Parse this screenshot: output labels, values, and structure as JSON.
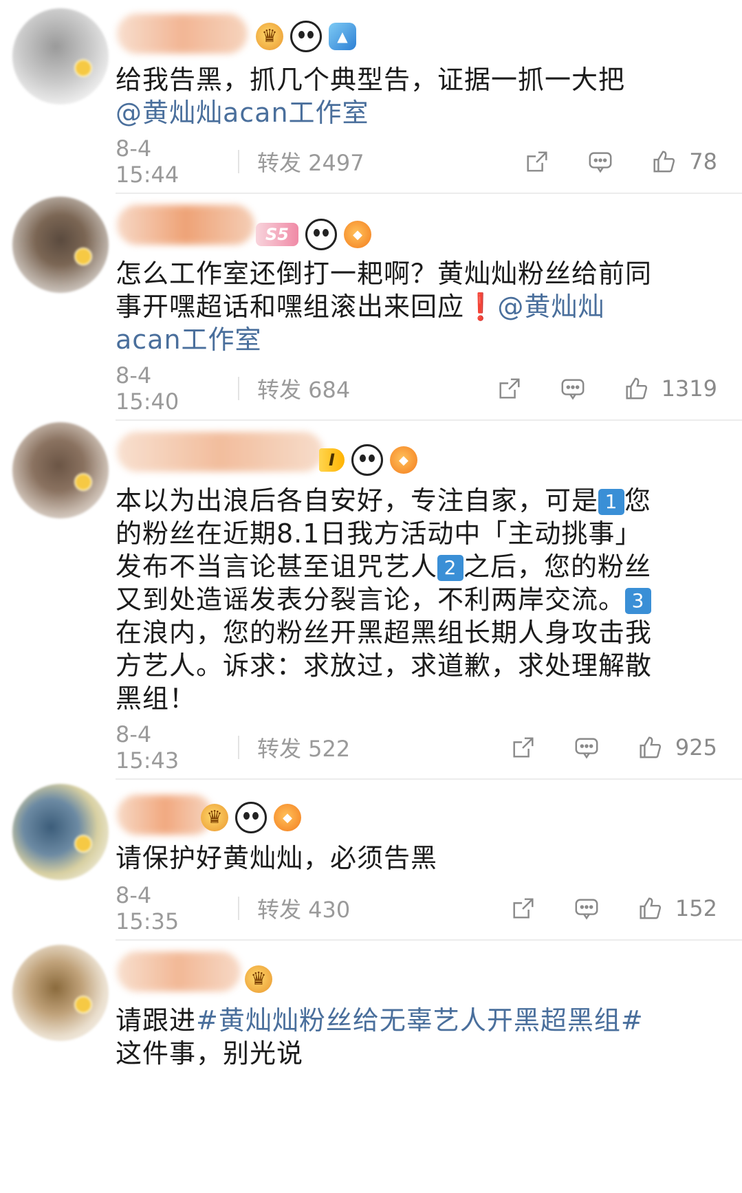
{
  "comments": [
    {
      "text_parts": [
        "给我告黑，抓几个典型告，证据一抓一大把",
        "@黄灿灿acan工作室"
      ],
      "time": "8-4 15:44",
      "repost": "转发 2497",
      "likes": "78",
      "badge_level": ""
    },
    {
      "text_parts": [
        "怎么工作室还倒打一耙啊？黄灿灿粉丝给前同事开嘿超话和嘿组滚出来回应",
        "❗",
        "@黄灿灿acan工作室"
      ],
      "time": "8-4 15:40",
      "repost": "转发 684",
      "likes": "1319",
      "badge_level": "S5"
    },
    {
      "text_parts": [
        "本以为出浪后各自安好，专注自家，可是",
        "1",
        "您的粉丝在近期8.1日我方活动中「主动挑事」发布不当言论甚至诅咒艺人",
        "2",
        "之后，您的粉丝又到处造谣发表分裂言论，不利两岸交流。",
        "3",
        "在浪内，您的粉丝开黑超黑组长期人身攻击我方艺人。诉求：求放过，求道歉，求处理解散黑组！"
      ],
      "time": "8-4 15:43",
      "repost": "转发 522",
      "likes": "925",
      "badge_level": "I"
    },
    {
      "text_parts": [
        "请保护好黄灿灿，必须告黑"
      ],
      "time": "8-4 15:35",
      "repost": "转发 430",
      "likes": "152",
      "badge_level": ""
    },
    {
      "text_parts": [
        "请跟进",
        "#黄灿灿粉丝给无辜艺人开黑超黑组#",
        " 这件事，别光说"
      ],
      "time": "",
      "repost": "",
      "likes": "",
      "badge_level": ""
    }
  ],
  "icons": {
    "share": "share-icon",
    "comment": "comment-icon",
    "like": "thumb-up-icon"
  },
  "colors": {
    "link": "#4a6f9c",
    "meta": "#9a9a9a",
    "divider": "#ececec"
  }
}
